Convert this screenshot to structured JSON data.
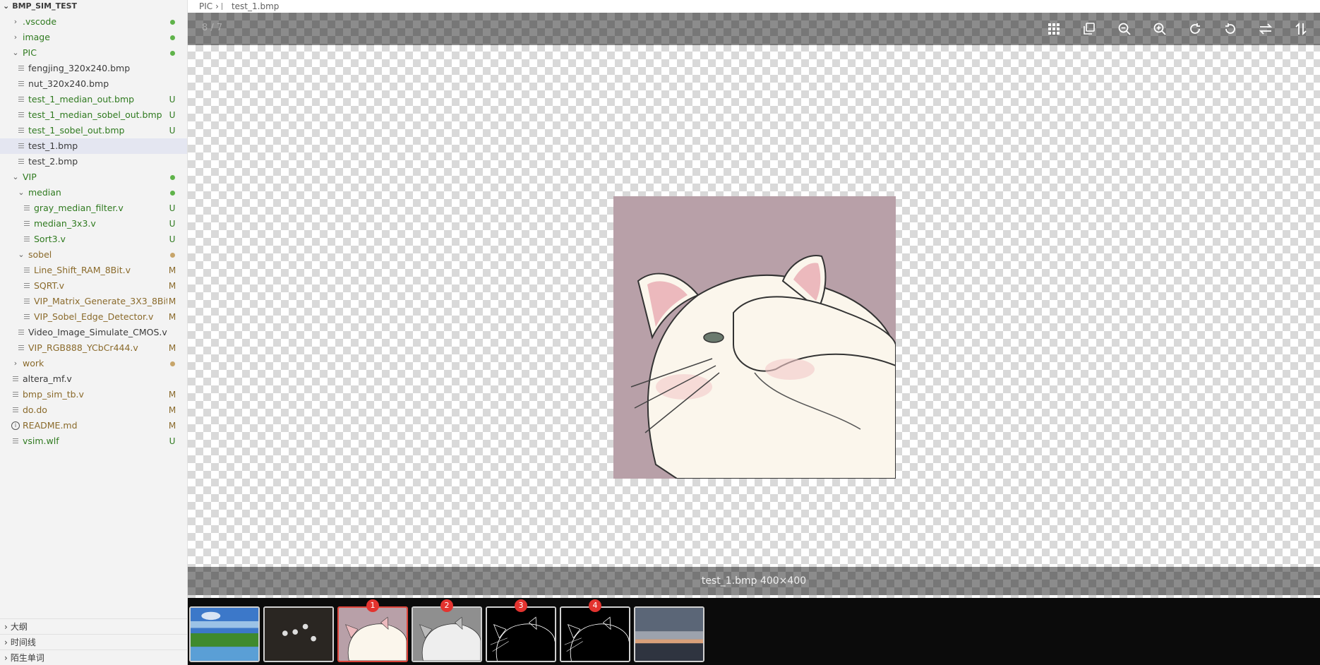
{
  "sidebar": {
    "root_label": "BMP_SIM_TEST",
    "items": [
      {
        "label": ".vscode",
        "type": "folder",
        "open": false,
        "depth": 1,
        "status": "dot",
        "color": "green"
      },
      {
        "label": "image",
        "type": "folder",
        "open": false,
        "depth": 1,
        "status": "dot",
        "color": "green"
      },
      {
        "label": "PIC",
        "type": "folder",
        "open": true,
        "depth": 1,
        "status": "dot",
        "color": "green"
      },
      {
        "label": "fengjing_320x240.bmp",
        "type": "file",
        "depth": 2,
        "status": "",
        "color": ""
      },
      {
        "label": "nut_320x240.bmp",
        "type": "file",
        "depth": 2,
        "status": "",
        "color": ""
      },
      {
        "label": "test_1_median_out.bmp",
        "type": "file",
        "depth": 2,
        "status": "U",
        "color": "green"
      },
      {
        "label": "test_1_median_sobel_out.bmp",
        "type": "file",
        "depth": 2,
        "status": "U",
        "color": "green"
      },
      {
        "label": "test_1_sobel_out.bmp",
        "type": "file",
        "depth": 2,
        "status": "U",
        "color": "green"
      },
      {
        "label": "test_1.bmp",
        "type": "file",
        "depth": 2,
        "status": "",
        "color": "",
        "selected": true
      },
      {
        "label": "test_2.bmp",
        "type": "file",
        "depth": 2,
        "status": "",
        "color": ""
      },
      {
        "label": "VIP",
        "type": "folder",
        "open": true,
        "depth": 1,
        "status": "dot",
        "color": "green"
      },
      {
        "label": "median",
        "type": "folder",
        "open": true,
        "depth": 2,
        "status": "dot",
        "color": "green"
      },
      {
        "label": "gray_median_filter.v",
        "type": "file",
        "depth": 3,
        "status": "U",
        "color": "green"
      },
      {
        "label": "median_3x3.v",
        "type": "file",
        "depth": 3,
        "status": "U",
        "color": "green"
      },
      {
        "label": "Sort3.v",
        "type": "file",
        "depth": 3,
        "status": "U",
        "color": "green"
      },
      {
        "label": "sobel",
        "type": "folder",
        "open": true,
        "depth": 2,
        "status": "dot",
        "color": "brown"
      },
      {
        "label": "Line_Shift_RAM_8Bit.v",
        "type": "file",
        "depth": 3,
        "status": "M",
        "color": "brown"
      },
      {
        "label": "SQRT.v",
        "type": "file",
        "depth": 3,
        "status": "M",
        "color": "brown"
      },
      {
        "label": "VIP_Matrix_Generate_3X3_8Bit.v",
        "type": "file",
        "depth": 3,
        "status": "M",
        "color": "brown"
      },
      {
        "label": "VIP_Sobel_Edge_Detector.v",
        "type": "file",
        "depth": 3,
        "status": "M",
        "color": "brown"
      },
      {
        "label": "Video_Image_Simulate_CMOS.v",
        "type": "file",
        "depth": 2,
        "status": "",
        "color": ""
      },
      {
        "label": "VIP_RGB888_YCbCr444.v",
        "type": "file",
        "depth": 2,
        "status": "M",
        "color": "brown"
      },
      {
        "label": "work",
        "type": "folder",
        "open": false,
        "depth": 1,
        "status": "dot",
        "color": "brown"
      },
      {
        "label": "altera_mf.v",
        "type": "file",
        "depth": 1,
        "status": "",
        "color": ""
      },
      {
        "label": "bmp_sim_tb.v",
        "type": "file",
        "depth": 1,
        "status": "M",
        "color": "brown"
      },
      {
        "label": "do.do",
        "type": "file",
        "depth": 1,
        "status": "M",
        "color": "brown"
      },
      {
        "label": "README.md",
        "type": "info",
        "depth": 1,
        "status": "M",
        "color": "brown"
      },
      {
        "label": "vsim.wlf",
        "type": "file",
        "depth": 1,
        "status": "U",
        "color": "green"
      }
    ],
    "panels": [
      "大纲",
      "时间线",
      "陌生单词"
    ]
  },
  "breadcrumb": {
    "folder": "PIC",
    "file": "test_1.bmp"
  },
  "viewer": {
    "counter": "8 / 7",
    "caption": "test_1.bmp 400×400",
    "tools": [
      "grid-icon",
      "copy-icon",
      "zoom-out-icon",
      "zoom-in-icon",
      "rotate-right-icon",
      "rotate-left-icon",
      "flip-horizontal-icon",
      "flip-vertical-icon"
    ],
    "thumbnails": [
      {
        "name": "landscape",
        "badge": ""
      },
      {
        "name": "nuts",
        "badge": ""
      },
      {
        "name": "cat-color",
        "badge": "1",
        "active": true
      },
      {
        "name": "cat-gray",
        "badge": "2"
      },
      {
        "name": "cat-edge-1",
        "badge": "3"
      },
      {
        "name": "cat-edge-2",
        "badge": "4"
      },
      {
        "name": "city-dusk",
        "badge": ""
      }
    ]
  },
  "colors": {
    "u_status": "#2f7a1f",
    "m_status": "#8a6a2b",
    "accent_red": "#e3332f"
  }
}
